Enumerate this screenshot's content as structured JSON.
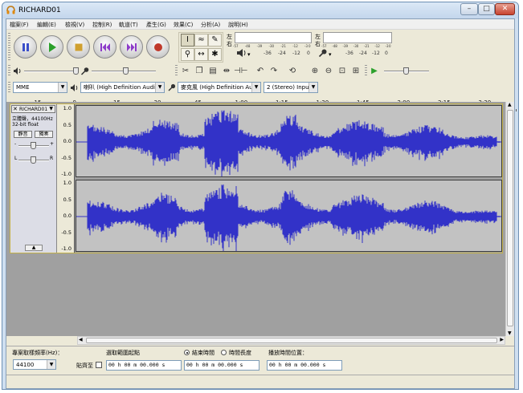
{
  "window": {
    "title": "RICHARD01",
    "min_glyph": "–",
    "max_glyph": "□",
    "close_glyph": "✕"
  },
  "menu": [
    "檔案(F)",
    "編輯(E)",
    "檢視(V)",
    "控制(R)",
    "軌道(T)",
    "產生(G)",
    "效果(C)",
    "分析(A)",
    "說明(H)"
  ],
  "meters": {
    "left": "左",
    "right": "右",
    "scale_top": [
      "-57",
      "-54",
      "-51",
      "-48",
      "-45",
      "-42",
      "-39",
      "-36",
      "-33",
      "-30",
      "-27",
      "-24",
      "-21",
      "-18",
      "-15",
      "-12",
      "-9",
      "-6",
      "-3",
      "0"
    ],
    "scale_bottom_out": [
      "-36",
      "-24",
      "-12",
      "0"
    ],
    "scale_bottom_in": [
      "-36",
      "-24",
      "-12",
      "0"
    ]
  },
  "devices": {
    "host": "MME",
    "output": "喇叭 (High Definition Audio",
    "input": "麥克風 (High Definition Au",
    "channels": "2 (Stereo) Inpu"
  },
  "ruler": [
    "-15",
    "0",
    "15",
    "30",
    "45",
    "1:00",
    "1:15",
    "1:30",
    "1:45",
    "2:00",
    "2:15",
    "2:30"
  ],
  "track": {
    "name": "RICHARD01",
    "info1": "立體聲，44100Hz",
    "info2": "32-bit float",
    "mute": "靜音",
    "solo": "獨奏",
    "gain_minus": "-",
    "gain_plus": "+",
    "pan_left": "L",
    "pan_right": "R",
    "yaxis": [
      "1.0",
      "0.5",
      "0.0",
      "-0.5",
      "-1.0"
    ]
  },
  "selection": {
    "rate_label": "專案取樣頻率(Hz)：",
    "rate_value": "44100",
    "snap_label": "貼齊至",
    "sel_label": "選取範圍起點",
    "end_label": "結束時間",
    "len_label": "時間長度",
    "audio_pos_label": "播放時間位置：",
    "start_time": "00 h 00 m 00.000 s",
    "end_time": "00 h 00 m 00.000 s",
    "audio_pos": "00 h 00 m 00.000 s"
  },
  "colors": {
    "waveform": "#3232c8",
    "track_border": "#c4b24a",
    "play_green": "#2ca02c",
    "record_red": "#c0392b",
    "transport_blue": "#3b4fc9"
  }
}
